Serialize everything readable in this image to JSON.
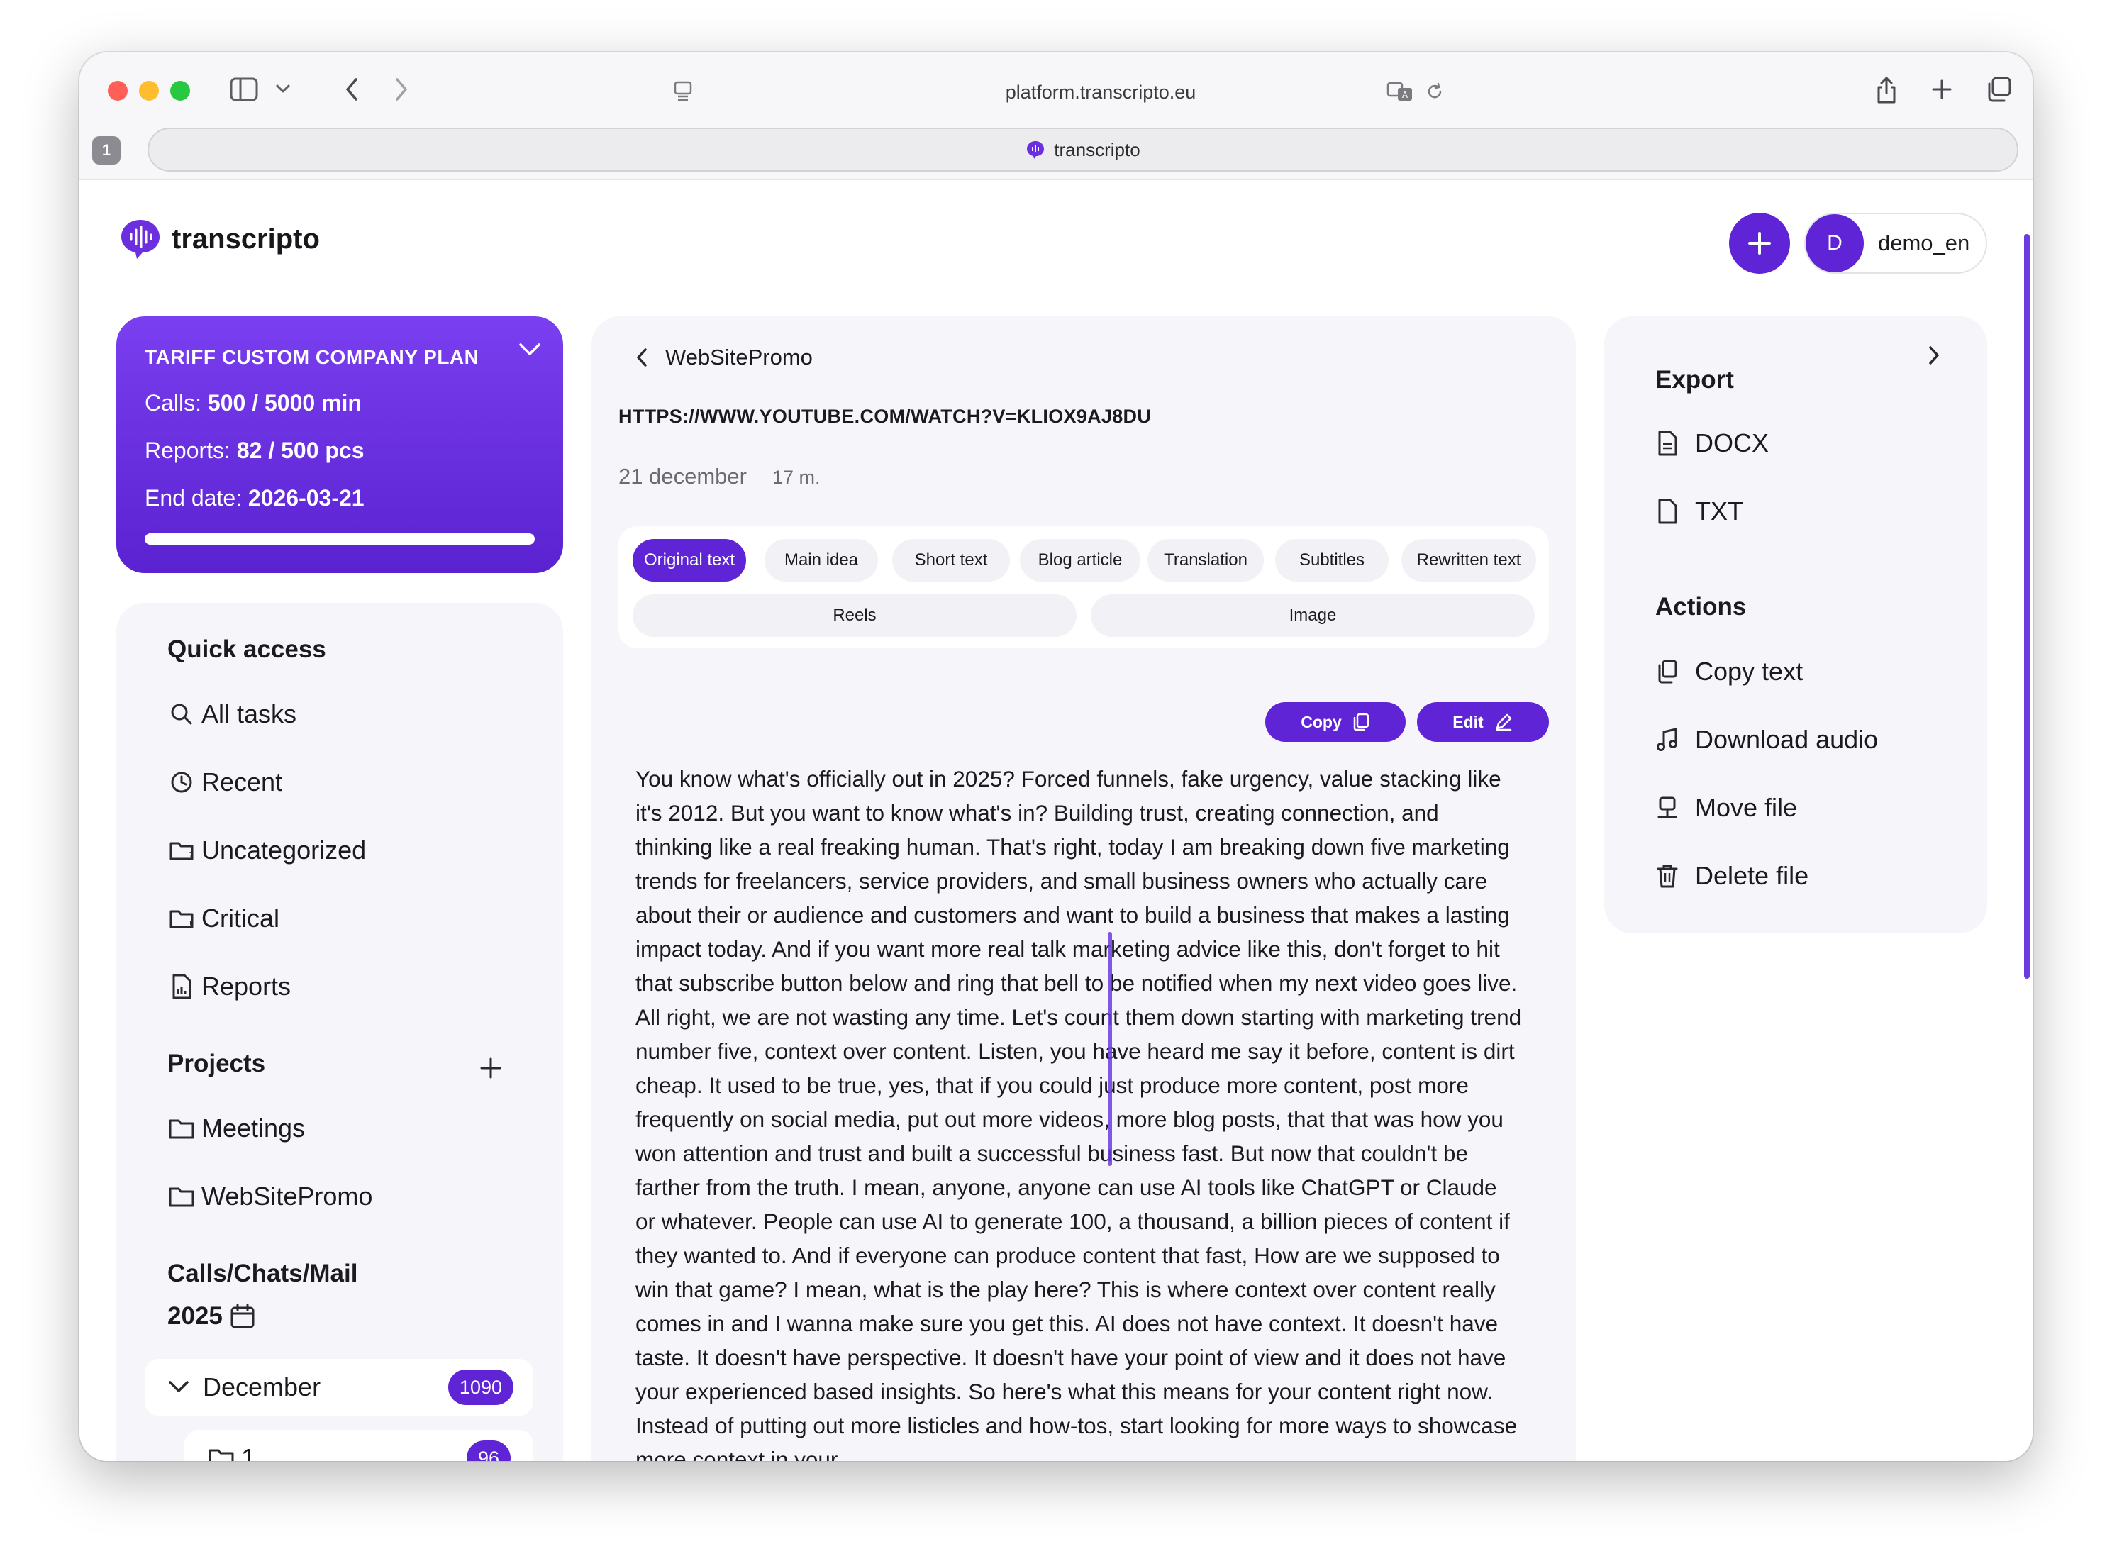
{
  "browser": {
    "url": "platform.transcripto.eu",
    "tab_count": "1",
    "tab_title": "transcripto"
  },
  "app": {
    "brand": "transcripto",
    "user": {
      "initial": "D",
      "name": "demo_en"
    }
  },
  "tariff": {
    "title": "TARIFF CUSTOM COMPANY PLAN",
    "calls_label": "Calls:",
    "calls_value": "500 / 5000 min",
    "reports_label": "Reports:",
    "reports_value": "82 / 500 pcs",
    "end_label": "End date:",
    "end_value": "2026-03-21",
    "progress_fraction": 1.0
  },
  "sidebar": {
    "quick_access": "Quick access",
    "items": [
      "All tasks",
      "Recent",
      "Uncategorized",
      "Critical",
      "Reports"
    ],
    "projects_heading": "Projects",
    "projects": [
      "Meetings",
      "WebSitePromo"
    ],
    "calls_heading": "Calls/Chats/Mail",
    "year": "2025",
    "month": "December",
    "month_count": "1090",
    "folder": "1",
    "folder_count": "96"
  },
  "main": {
    "back_label": "WebSitePromo",
    "video_url": "HTTPS://WWW.YOUTUBE.COM/WATCH?V=KLIOX9AJ8DU",
    "date": "21 december",
    "duration": "17 m.",
    "tabs": [
      "Original text",
      "Main idea",
      "Short text",
      "Blog article",
      "Translation",
      "Subtitles",
      "Rewritten text",
      "Reels",
      "Image"
    ],
    "copy_label": "Copy",
    "edit_label": "Edit",
    "transcript": "You know what's officially out in 2025? Forced funnels, fake urgency, value stacking like it's 2012. But you want to know what's in? Building trust, creating connection, and thinking like a real freaking human. That's right, today I am breaking down five marketing trends for freelancers, service providers, and small business owners who actually care about their or audience and customers and want to build a business that makes a lasting impact today. And if you want more real talk marketing advice like this, don't forget to hit that subscribe button below and ring that bell to be notified when my next video goes live. All right, we are not wasting any time. Let's count them down starting with marketing trend number five, context over content. Listen, you have heard me say it before, content is dirt cheap. It used to be true, yes, that if you could just produce more content, post more frequently on social media, put out more videos, more blog posts, that that was how you won attention and trust and built a successful business fast. But now that couldn't be farther from the truth. I mean, anyone, anyone can use AI tools like ChatGPT or Claude or whatever. People can use AI to generate 100, a thousand, a billion pieces of content if they wanted to. And if everyone can produce content that fast, How are we supposed to win that game? I mean, what is the play here? This is where context over content really comes in and I wanna make sure you get this. AI does not have context. It doesn't have taste. It doesn't have perspective. It doesn't have your point of view and it does not have your experienced based insights. So here's what this means for your content right now. Instead of putting out more listicles and how-tos, start looking for more ways to showcase more context in your"
  },
  "right_panel": {
    "export_heading": "Export",
    "export_items": [
      "DOCX",
      "TXT"
    ],
    "actions_heading": "Actions",
    "action_items": [
      "Copy text",
      "Download audio",
      "Move file",
      "Delete file"
    ]
  },
  "colors": {
    "accent": "#5f24d6",
    "panel_bg": "#f6f6fa"
  }
}
